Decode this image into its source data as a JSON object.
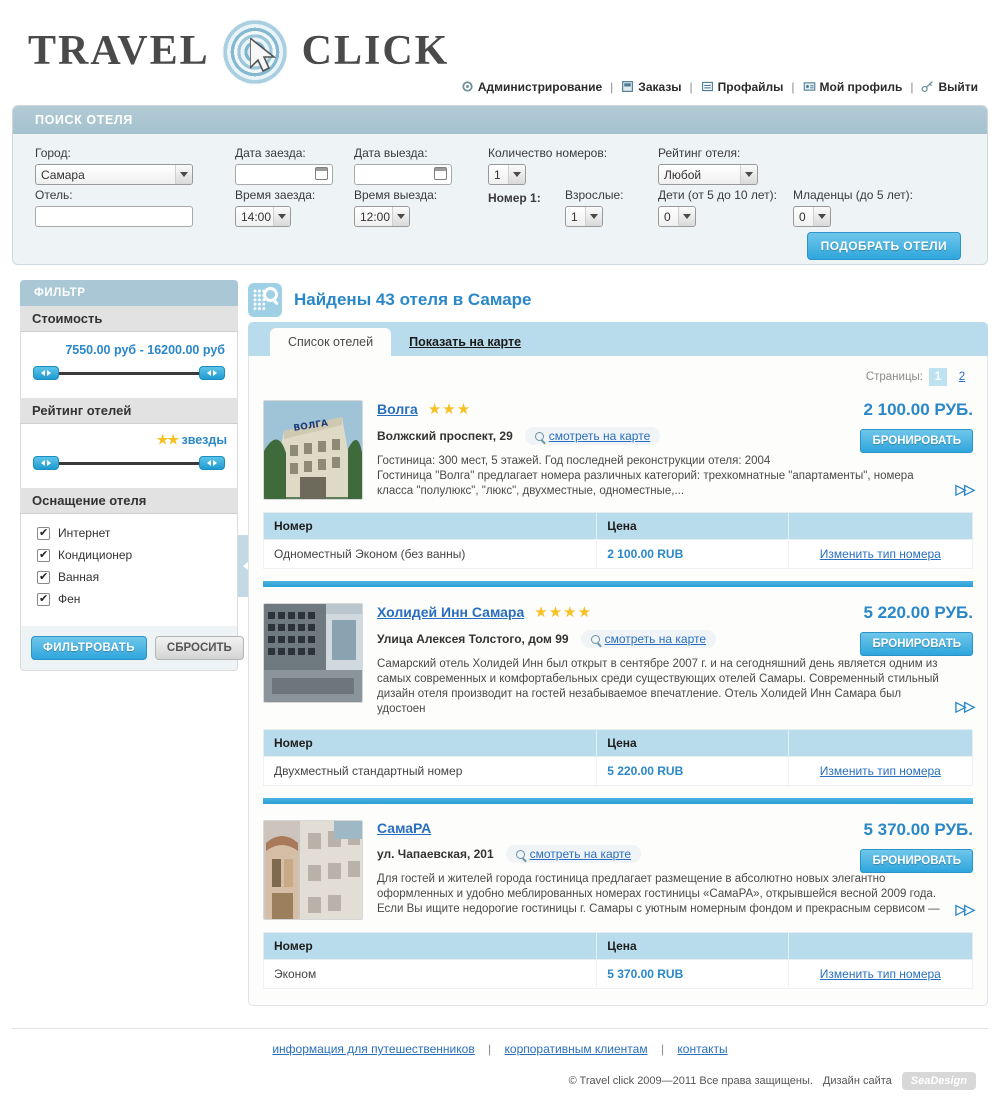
{
  "brand": {
    "word1": "TRAVEL",
    "word2": "CLICK",
    "logo_icon": "spiral-cursor-logo"
  },
  "topnav": [
    {
      "label": "Администрирование",
      "icon": "gear-icon"
    },
    {
      "label": "Заказы",
      "icon": "orders-icon"
    },
    {
      "label": "Профайлы",
      "icon": "profiles-icon"
    },
    {
      "label": "Мой профиль",
      "icon": "my-profile-icon"
    },
    {
      "label": "Выйти",
      "icon": "key-icon"
    }
  ],
  "search": {
    "title": "ПОИСК ОТЕЛЯ",
    "city_label": "Город:",
    "city_value": "Самара",
    "hotel_label": "Отель:",
    "hotel_value": "",
    "checkin_date_label": "Дата заезда:",
    "checkin_date_value": "",
    "checkout_date_label": "Дата выезда:",
    "checkout_date_value": "",
    "checkin_time_label": "Время заезда:",
    "checkin_time_value": "14:00",
    "checkout_time_label": "Время выезда:",
    "checkout_time_value": "12:00",
    "rooms_count_label": "Количество номеров:",
    "rooms_count_value": "1",
    "rating_label": "Рейтинг отеля:",
    "rating_value": "Любой",
    "room1_label": "Номер 1:",
    "adults_label": "Взрослые:",
    "adults_value": "1",
    "children_label": "Дети (от 5 до 10 лет):",
    "children_value": "0",
    "infants_label": "Младенцы (до 5 лет):",
    "infants_value": "0",
    "submit_label": "ПОДОБРАТЬ ОТЕЛИ"
  },
  "filter": {
    "title": "ФИЛЬТР",
    "price_section": "Стоимость",
    "price_range_text": "7550.00 руб - 16200.00 руб",
    "rating_section": "Рейтинг отелей",
    "rating_stars": "★★",
    "rating_text": "звезды",
    "amenities_section": "Оснащение отеля",
    "amenities": [
      {
        "label": "Интернет",
        "checked": true
      },
      {
        "label": "Кондиционер",
        "checked": true
      },
      {
        "label": "Ванная",
        "checked": true
      },
      {
        "label": "Фен",
        "checked": true
      }
    ],
    "apply_label": "ФИЛЬТРОВАТЬ",
    "reset_label": "СБРОСИТЬ",
    "collapse_icon": "chevron-left-icon"
  },
  "results": {
    "heading": "Найдены 43 отеля в Самаре",
    "heading_icon": "hotel-search-icon",
    "tabs": [
      {
        "label": "Список отелей",
        "active": true
      },
      {
        "label": "Показать на карте",
        "active": false
      }
    ],
    "pager_label": "Страницы:",
    "pages": [
      {
        "label": "1",
        "active": true
      },
      {
        "label": "2",
        "active": false
      }
    ],
    "table_headers": {
      "room": "Номер",
      "price": "Цена"
    },
    "map_link_label": "смотреть на карте",
    "book_label": "БРОНИРОВАТЬ",
    "change_room_label": "Изменить тип номера",
    "more_glyph": "▷▷",
    "hotels": [
      {
        "name": "Волга",
        "stars": "★★★",
        "star_count": 3,
        "address": "Волжский проспект, 29",
        "description": "Гостиница: 300 мест, 5 этажей. Год последней реконструкции отеля: 2004\nГостиница \"Волга\" предлагает номера различных категорий: трехкомнатные \"апартаменты\", номера класса \"полулюкс\", \"люкс\", двухместные, одноместные,...",
        "price": "2 100.00 РУБ.",
        "room_type": "Одноместный Эконом (без ванны)",
        "room_price": "2 100.00 RUB",
        "thumb": "hotel-volga-photo"
      },
      {
        "name": "Холидей Инн Самара",
        "stars": "★★★★",
        "star_count": 4,
        "address": "Улица Алексея Толстого, дом 99",
        "description": "Самарский отель Холидей Инн был открыт в сентябре 2007 г. и на сегодняшний день является одним из самых современных и комфортабельных среди существующих отелей Самары. Современный стильный дизайн отеля производит на гостей незабываемое впечатление. Отель Холидей Инн Самара был удостоен",
        "price": "5 220.00 РУБ.",
        "room_type": "Двухместный стандартный номер",
        "room_price": "5 220.00 RUB",
        "thumb": "hotel-holiday-inn-photo"
      },
      {
        "name": "СамаРА",
        "stars": "",
        "star_count": 0,
        "address": "ул. Чапаевская, 201",
        "description": "Для гостей и жителей города гостиница предлагает размещение в абсолютно новых элегантно оформленных и удобно меблированных номерах гостиницы «СамаРА», открывшейся весной 2009 года. Если Вы ищите недорогие гостиницы г. Самары с уютным номерным фондом и прекрасным сервисом —",
        "price": "5 370.00 РУБ.",
        "room_type": "Эконом",
        "room_price": "5 370.00 RUB",
        "thumb": "hotel-samara-photo"
      }
    ]
  },
  "footer": {
    "links": [
      "информация для путешественников",
      "корпоративным клиентам",
      "контакты"
    ],
    "copyright": "© Travel click  2009—2011  Все права защищены.",
    "design_label": "Дизайн сайта",
    "design_badge": "SeaDesign"
  },
  "colors": {
    "accent_blue": "#2a87c8",
    "link_blue": "#2a6fbf",
    "panel_header": "#a9c7d4",
    "tab_bar": "#b9dcec",
    "star_yellow": "#f5c125"
  }
}
